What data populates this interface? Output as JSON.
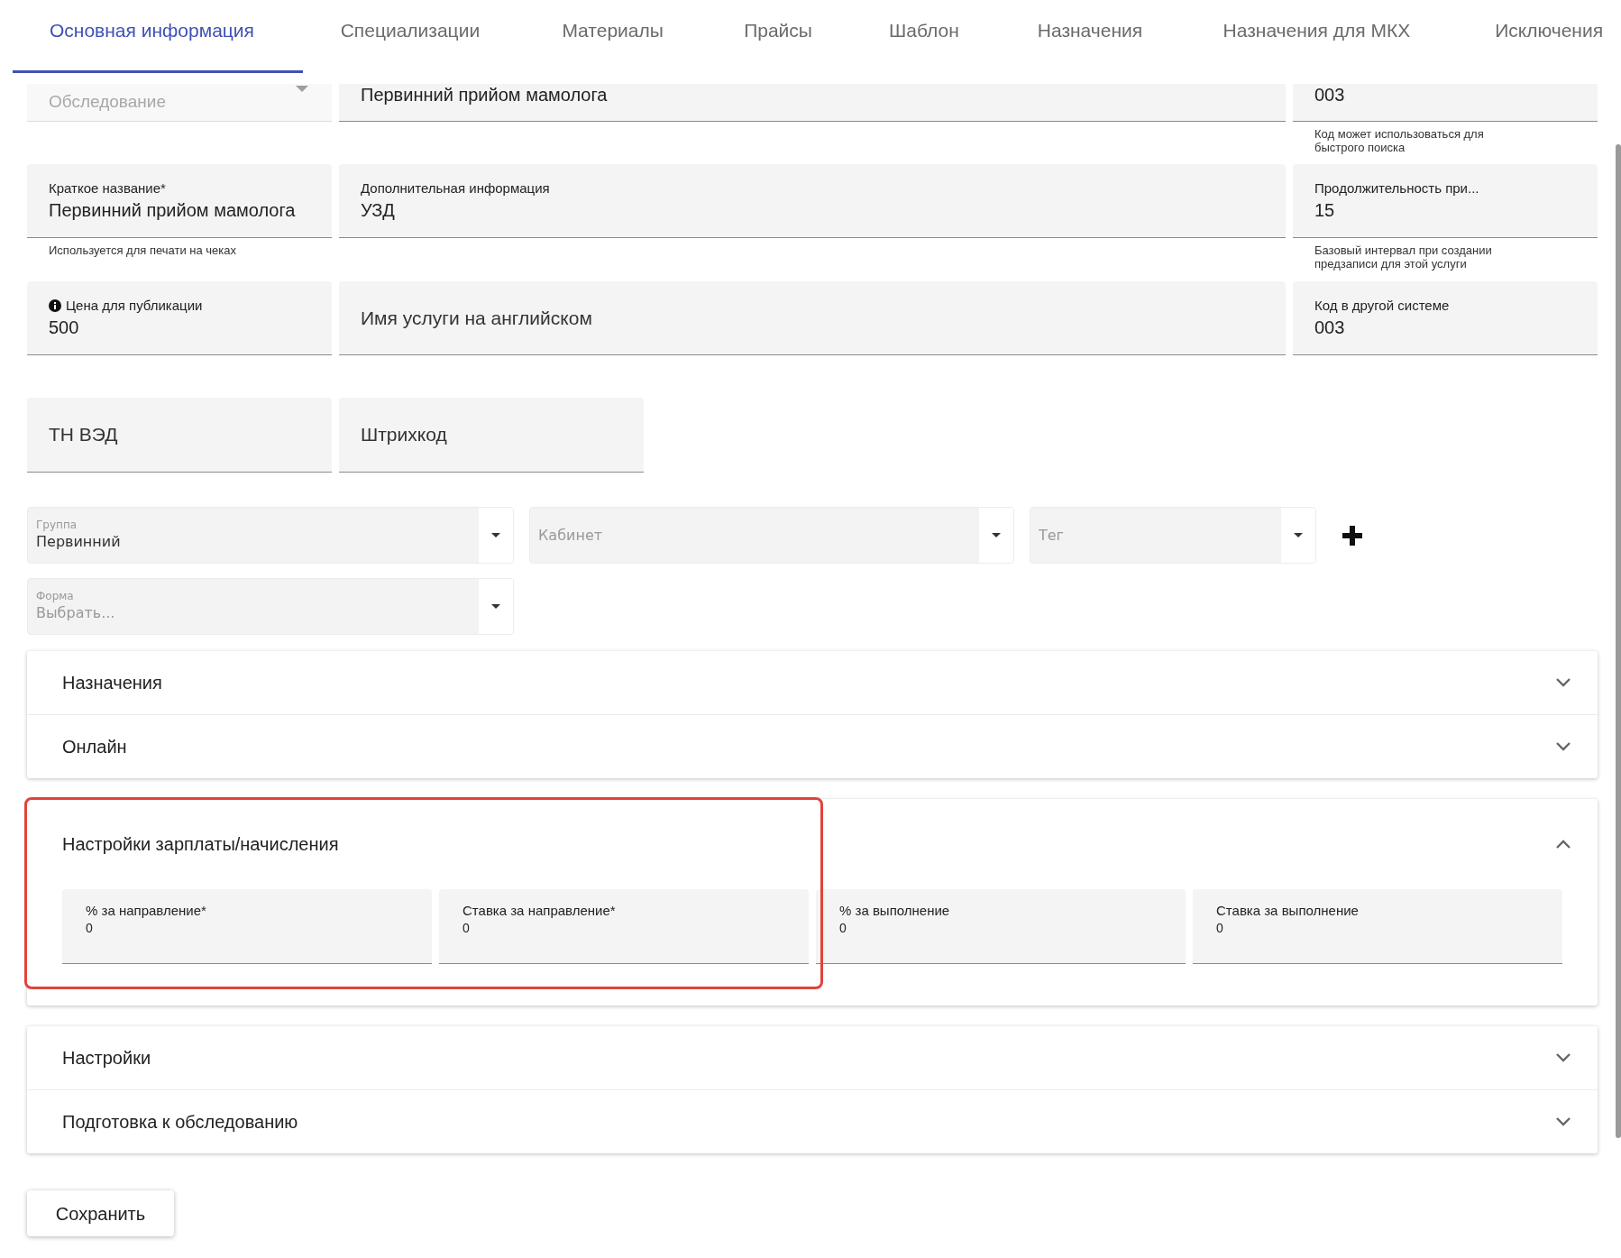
{
  "tabs": [
    {
      "label": "Основная информация",
      "selected": true
    },
    {
      "label": "Специализации",
      "selected": false
    },
    {
      "label": "Материалы",
      "selected": false
    },
    {
      "label": "Прайсы",
      "selected": false
    },
    {
      "label": "Шаблон",
      "selected": false
    },
    {
      "label": "Назначения",
      "selected": false
    },
    {
      "label": "Назначения для МКХ",
      "selected": false
    },
    {
      "label": "Исключения",
      "selected": false
    }
  ],
  "form_rows": [
    {
      "fields": [
        {
          "kind": "locked_select",
          "value": "Обследование"
        },
        {
          "kind": "text",
          "value": "Первинний прийом мамолога"
        },
        {
          "kind": "text",
          "value": "003",
          "helper": "Код может использоваться для\nбыстрого поиска"
        }
      ]
    },
    {
      "fields": [
        {
          "kind": "text",
          "label": "Краткое название*",
          "value": "Первинний прийом мамолога",
          "helper": "Используется для печати на чеках"
        },
        {
          "kind": "text",
          "label": "Дополнительная информация",
          "value": "УЗД"
        },
        {
          "kind": "text",
          "label": "Продолжительность при...",
          "value": "15",
          "helper": "Базовый интервал при создании\nпредзаписи для этой услуги"
        }
      ]
    },
    {
      "fields": [
        {
          "kind": "text",
          "label": "Цена для публикации",
          "info": true,
          "value": "500"
        },
        {
          "kind": "text",
          "placeholder": "Имя услуги на английском"
        },
        {
          "kind": "text",
          "label": "Код в другой системе",
          "value": "003"
        }
      ]
    },
    {
      "fields": [
        {
          "kind": "text",
          "placeholder": "ТН ВЭД"
        },
        {
          "kind": "text",
          "placeholder": "Штрихкод"
        }
      ]
    }
  ],
  "select_rows": [
    {
      "selects": [
        {
          "label": "Группа",
          "value": "Первинний"
        },
        {
          "placeholder": "Кабинет"
        },
        {
          "placeholder": "Тег"
        }
      ],
      "add_button": true
    },
    {
      "selects": [
        {
          "label": "Форма",
          "placeholder": "Выбрать..."
        }
      ],
      "add_button": false
    }
  ],
  "panels": [
    {
      "sections": [
        {
          "title": "Назначения",
          "expanded": false
        },
        {
          "title": "Онлайн",
          "expanded": false
        }
      ]
    },
    {
      "highlighted": true,
      "sections": [
        {
          "title": "Настройки зарплаты/начисления",
          "expanded": true,
          "fields": [
            {
              "label": "% за направление*",
              "value": "0"
            },
            {
              "label": "Ставка за направление*",
              "value": "0"
            },
            {
              "label": "% за выполнение",
              "value": "0"
            },
            {
              "label": "Ставка за выполнение",
              "value": "0"
            }
          ]
        }
      ]
    },
    {
      "sections": [
        {
          "title": "Настройки",
          "expanded": false
        },
        {
          "title": "Подготовка к обследованию",
          "expanded": false
        }
      ]
    }
  ],
  "save_button": "Сохранить"
}
